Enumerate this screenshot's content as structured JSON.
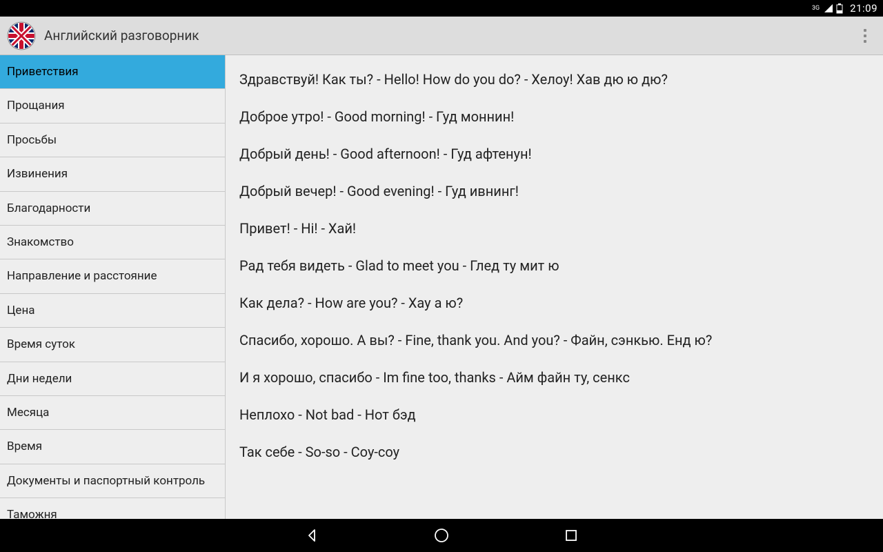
{
  "status": {
    "network_label": "3G",
    "time": "21:09"
  },
  "header": {
    "title": "Английский разговорник"
  },
  "sidebar": {
    "items": [
      {
        "label": "Приветствия",
        "active": true
      },
      {
        "label": "Прощания",
        "active": false
      },
      {
        "label": "Просьбы",
        "active": false
      },
      {
        "label": "Извинения",
        "active": false
      },
      {
        "label": "Благодарности",
        "active": false
      },
      {
        "label": "Знакомство",
        "active": false
      },
      {
        "label": "Направление и расстояние",
        "active": false
      },
      {
        "label": "Цена",
        "active": false
      },
      {
        "label": "Время суток",
        "active": false
      },
      {
        "label": "Дни недели",
        "active": false
      },
      {
        "label": "Месяца",
        "active": false
      },
      {
        "label": "Время",
        "active": false
      },
      {
        "label": "Документы и паспортный контроль",
        "active": false
      },
      {
        "label": "Таможня",
        "active": false
      }
    ]
  },
  "phrases": [
    "Здравствуй! Как ты? - Hello! How do you do? - Хелоу! Хав дю ю дю?",
    "Доброе утро! - Good morning! - Гуд моннин!",
    "Добрый день! - Good afternoon! - Гуд афтенун!",
    "Добрый вечер! - Good evening! - Гуд ивнинг!",
    "Привет! - Hi! - Хай!",
    "Рад тебя видеть - Glad to meet you - Глед ту мит ю",
    "Как дела? - How are you? - Хау а ю?",
    "Спасибо, хорошо. А вы? - Fine, thank you. And you? - Файн, сэнкью. Енд ю?",
    "И я хорошо, спасибо - Im fine too, thanks - Айм файн ту, сенкс",
    "Неплохо - Not bad - Нот бэд",
    "Так себе - So-so - Соу-соу"
  ]
}
